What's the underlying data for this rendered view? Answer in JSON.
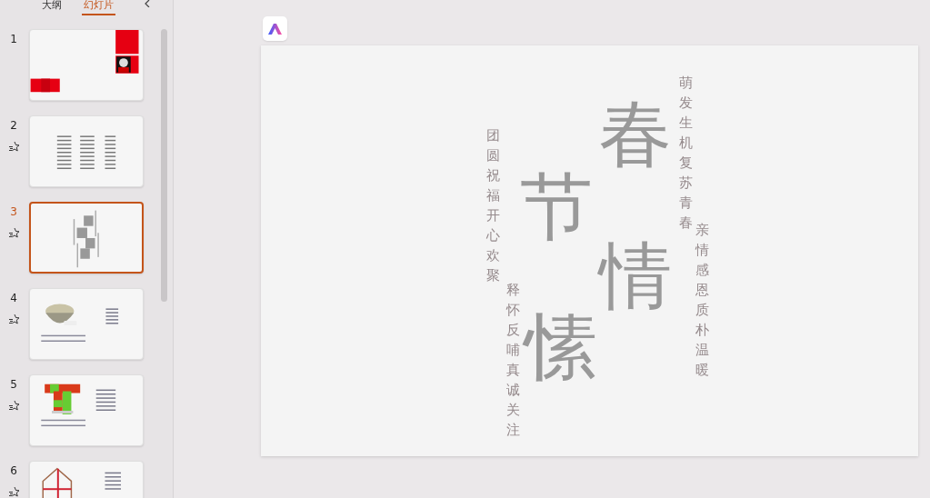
{
  "panel_tabs": [
    {
      "label": "大纲",
      "selected": false
    },
    {
      "label": "幻灯片",
      "selected": true
    }
  ],
  "slides": [
    {
      "number": "1",
      "kind": "red-blocks",
      "animated": false,
      "selected": false
    },
    {
      "number": "2",
      "kind": "text-columns",
      "animated": true,
      "selected": false
    },
    {
      "number": "3",
      "kind": "vertical-title",
      "animated": true,
      "selected": true
    },
    {
      "number": "4",
      "kind": "bowl",
      "animated": true,
      "selected": false
    },
    {
      "number": "5",
      "kind": "scarf",
      "animated": true,
      "selected": false
    },
    {
      "number": "6",
      "kind": "house",
      "animated": true,
      "selected": false
    }
  ],
  "slide": {
    "title": "春节情愫",
    "phrases": [
      "萌发生机复苏青春",
      "团圆祝福开心欢聚",
      "亲情感恩质朴温暖",
      "释怀反哺真诚关注"
    ]
  }
}
